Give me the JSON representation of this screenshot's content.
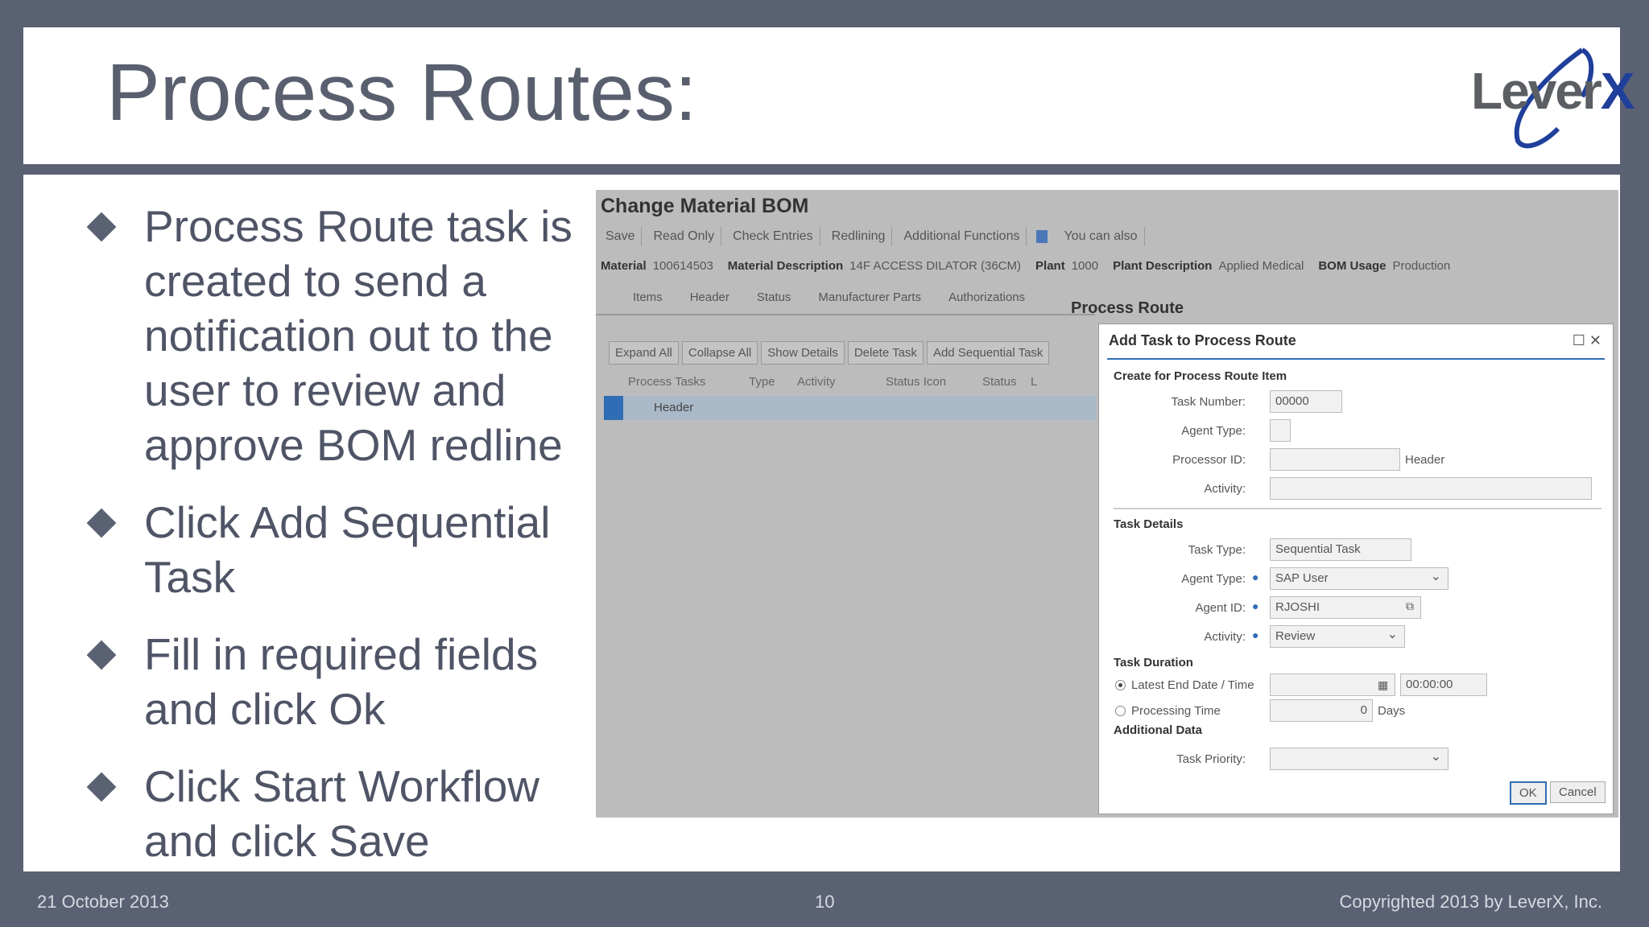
{
  "slide": {
    "title": "Process Routes:",
    "logo_text": "Lever",
    "logo_x": "X",
    "bullets": [
      "Process Route task is created to send a notification out to the user to review and approve BOM redline",
      "Click Add Sequential Task",
      "Fill in required fields and click Ok",
      "Click Start Workflow and click Save"
    ],
    "footer": {
      "date": "21 October 2013",
      "page": "10",
      "copyright": "Copyrighted 2013 by LeverX, Inc."
    }
  },
  "sap": {
    "title": "Change Material BOM",
    "toolbar": [
      "Save",
      "Read Only",
      "Check Entries",
      "Redlining",
      "Additional Functions",
      "You can also"
    ],
    "info": {
      "material_label": "Material",
      "material": "100614503",
      "desc_label": "Material Description",
      "desc": "14F ACCESS DILATOR (36CM)",
      "plant_label": "Plant",
      "plant": "1000",
      "plant_desc_label": "Plant Description",
      "plant_desc": "Applied Medical",
      "usage_label": "BOM Usage",
      "usage": "Production"
    },
    "tabs": [
      "Items",
      "Header",
      "Status",
      "Manufacturer Parts",
      "Authorizations"
    ],
    "active_tab": "Process Route",
    "buttons": [
      "Expand All",
      "Collapse All",
      "Show Details",
      "Delete Task",
      "Add Sequential Task"
    ],
    "columns": [
      "Process Tasks",
      "Type",
      "Activity",
      "Status Icon",
      "Status",
      "L"
    ],
    "row": "Header",
    "dialog": {
      "title": "Add Task to Process Route",
      "section_create": "Create for Process Route Item",
      "task_number_label": "Task Number:",
      "task_number": "00000",
      "agent_type_label": "Agent Type:",
      "processor_label": "Processor ID:",
      "processor_suffix": "Header",
      "activity_label": "Activity:",
      "section_details": "Task Details",
      "task_type_label": "Task Type:",
      "task_type": "Sequential Task",
      "agent_type2_label": "Agent Type:",
      "agent_type2": "SAP User",
      "agent_id_label": "Agent ID:",
      "agent_id": "RJOSHI",
      "activity2_label": "Activity:",
      "activity2": "Review",
      "section_duration": "Task Duration",
      "latest_end_label": "Latest End Date / Time",
      "time": "00:00:00",
      "processing_label": "Processing Time",
      "processing_value": "0",
      "days": "Days",
      "section_additional": "Additional Data",
      "priority_label": "Task Priority:",
      "ok": "OK",
      "cancel": "Cancel"
    }
  }
}
